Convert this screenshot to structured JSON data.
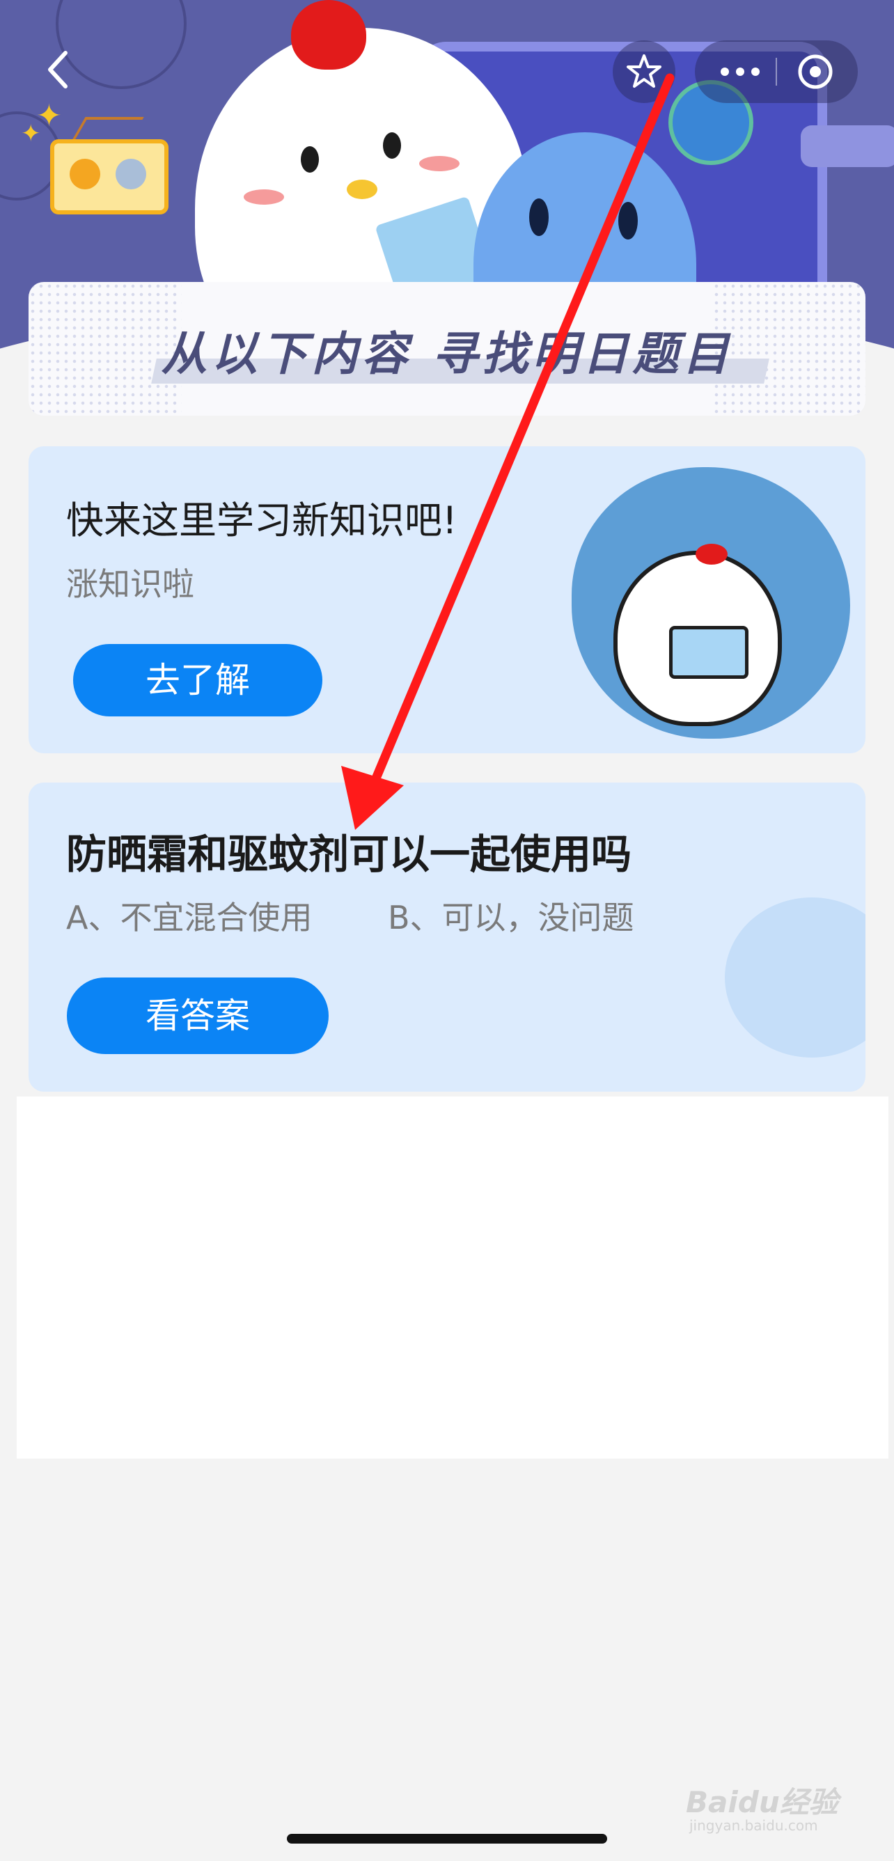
{
  "nav": {
    "back_icon": "chevron-left-icon",
    "star_icon": "star-icon",
    "more_icon": "more-dots-icon",
    "close_icon": "target-circle-icon"
  },
  "banner": {
    "title": "从以下内容 寻找明日题目"
  },
  "learn_card": {
    "title": "快来这里学习新知识吧!",
    "subtitle": "涨知识啦",
    "button_label": "去了解"
  },
  "question_card": {
    "question": "防晒霜和驱蚊剂可以一起使用吗",
    "option_a": "A、不宜混合使用",
    "option_b": "B、可以，没问题",
    "button_label": "看答案"
  },
  "watermark": {
    "brand": "Baidu经验",
    "url": "jingyan.baidu.com"
  },
  "colors": {
    "header_bg": "#5b5fa6",
    "card_bg": "#dcebfd",
    "button_blue": "#0b84f5",
    "annotation_arrow": "#ff1a1a"
  }
}
